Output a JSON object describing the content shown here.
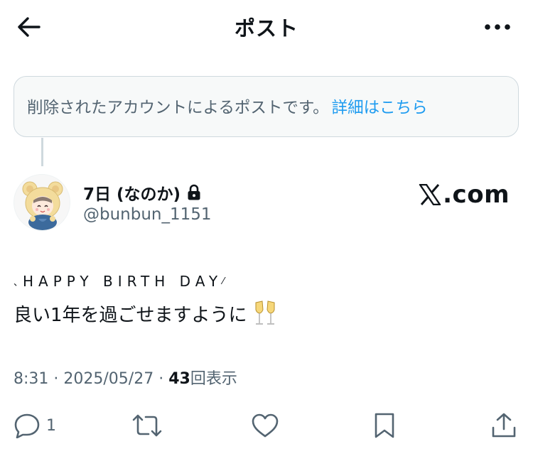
{
  "header": {
    "title": "ポスト",
    "back_icon": "arrow-left-icon",
    "more_icon": "more-horizontal-icon"
  },
  "notice": {
    "text": "削除されたアカウントによるポストです。",
    "link_label": "詳細はこちら"
  },
  "author": {
    "display_name": "7日 (なのか)",
    "handle": "@bunbun_1151",
    "protected_icon": "lock-icon",
    "avatar_icon": "bear-hood-avatar"
  },
  "watermark": {
    "prefix": "𝕏",
    "text": ".com"
  },
  "post": {
    "line1_left": "、",
    "line1_text": "HAPPY BIRTH DAY",
    "line1_right": "⁄",
    "line2_text": "良い1年を過ごせますように",
    "emoji": "champagne-glasses-icon"
  },
  "meta": {
    "time": "8:31",
    "sep1": " · ",
    "date": "2025/05/27",
    "sep2": " · ",
    "views_count": "43",
    "views_label": "回表示"
  },
  "actions": {
    "reply_count": "1",
    "reply_icon": "reply-icon",
    "repost_icon": "repost-icon",
    "like_icon": "heart-icon",
    "bookmark_icon": "bookmark-icon",
    "share_icon": "share-icon"
  },
  "colors": {
    "text": "#0f1419",
    "secondary": "#536471",
    "link": "#1d9bf0",
    "border": "#cfd9de",
    "notice_bg": "#f7f9f9"
  }
}
